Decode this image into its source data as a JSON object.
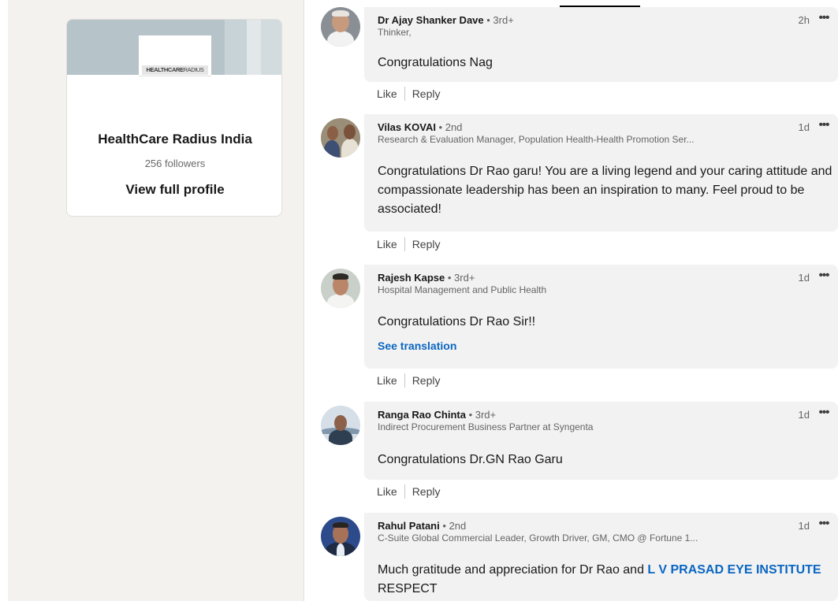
{
  "sidebar": {
    "org_logo_text_bold": "HEALTHCARE",
    "org_logo_text_thin": "RADIUS",
    "org_name": "HealthCare Radius India",
    "followers": "256 followers",
    "view_profile": "View full profile"
  },
  "actions": {
    "like": "Like",
    "reply": "Reply",
    "more": "•••"
  },
  "comments": [
    {
      "name": "Dr Ajay Shanker Dave",
      "degree": " • 3rd+",
      "headline": "Thinker,",
      "time": "2h",
      "text": "Congratulations Nag"
    },
    {
      "name": "Vilas KOVAI",
      "degree": " • 2nd",
      "headline": "Research & Evaluation Manager, Population Health-Health Promotion Ser...",
      "time": "1d",
      "text": "Congratulations Dr Rao garu! You are a living legend and your caring attitude and compassionate leadership has been an inspiration to many. Feel proud to be associated!"
    },
    {
      "name": "Rajesh Kapse",
      "degree": " • 3rd+",
      "headline": "Hospital Management and Public Health",
      "time": "1d",
      "text": "Congratulations Dr Rao Sir!!",
      "see_translation": "See translation"
    },
    {
      "name": "Ranga Rao Chinta",
      "degree": " • 3rd+",
      "headline": "Indirect Procurement Business Partner at Syngenta",
      "time": "1d",
      "text": "Congratulations Dr.GN Rao Garu"
    },
    {
      "name": "Rahul Patani",
      "degree": " • 2nd",
      "headline": "C-Suite Global Commercial Leader, Growth Driver, GM, CMO @ Fortune 1...",
      "time": "1d",
      "text_before": "Much gratitude and appreciation for Dr Rao and ",
      "text_mention": "L V PRASAD EYE INSTITUTE",
      "text_after": " RESPECT"
    }
  ],
  "colors": {
    "link_blue": "#0a66c2",
    "page_bg": "#f3f2ef",
    "bubble_bg": "#f2f2f2"
  }
}
